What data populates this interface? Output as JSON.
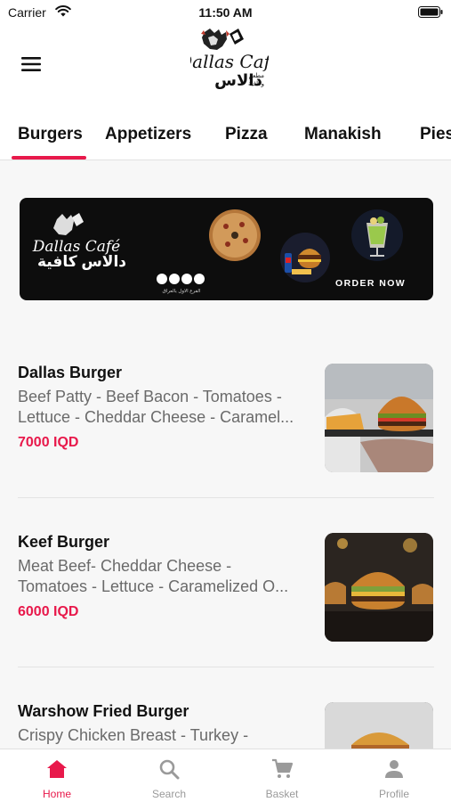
{
  "status_bar": {
    "carrier": "Carrier",
    "time": "11:50 AM"
  },
  "header": {
    "menu_icon": "hamburger-menu-icon",
    "logo": {
      "latin": "Dallas Café",
      "arabic": "دالاس",
      "arabic_small": "مطعم وكافية"
    }
  },
  "tabs": [
    {
      "label": "Burgers",
      "active": true
    },
    {
      "label": "Appetizers",
      "active": false
    },
    {
      "label": "Pizza",
      "active": false
    },
    {
      "label": "Manakish",
      "active": false
    },
    {
      "label": "Pies",
      "active": false
    }
  ],
  "banner": {
    "logo_latin": "Dallas Café",
    "logo_arabic": "دالاس كافية",
    "cta": "ORDER NOW",
    "tagline": "الفرع الاول بالعراق"
  },
  "items": [
    {
      "name": "Dallas Burger",
      "desc_line1": "Beef Patty - Beef Bacon - Tomatoes -",
      "desc_line2": "Lettuce - Cheddar Cheese - Caramel...",
      "price": "7000 IQD"
    },
    {
      "name": "Keef Burger",
      "desc_line1": "Meat Beef- Cheddar Cheese -",
      "desc_line2": "Tomatoes - Lettuce - Caramelized O...",
      "price": "6000 IQD"
    },
    {
      "name": "Warshow Fried Burger",
      "desc_line1": "Crispy Chicken Breast - Turkey -",
      "desc_line2": "",
      "price": ""
    }
  ],
  "bottom_nav": [
    {
      "label": "Home",
      "icon": "home-icon",
      "active": true
    },
    {
      "label": "Search",
      "icon": "search-icon",
      "active": false
    },
    {
      "label": "Basket",
      "icon": "cart-icon",
      "active": false
    },
    {
      "label": "Profile",
      "icon": "person-icon",
      "active": false
    }
  ],
  "colors": {
    "accent": "#e8194b",
    "text": "#111111",
    "muted": "#6a6a6a",
    "inactive_nav": "#9a9a9a"
  }
}
